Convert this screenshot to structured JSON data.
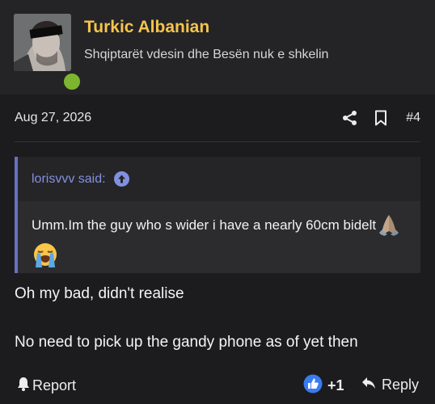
{
  "user": {
    "name": "Turkic Albanian",
    "title": "Shqiptarët vdesin dhe Besën nuk e shkelin",
    "online": true
  },
  "post": {
    "date": "Aug 27, 2026",
    "number": "#4",
    "share_icon": "share-icon",
    "bookmark_icon": "bookmark-icon"
  },
  "quote": {
    "author": "lorisvvv said:",
    "arrow_icon": "arrow-up-circle-icon",
    "text": "Umm.Im the guy who s wider i have a nearly 60cm bidelt",
    "emojis": [
      "folded-hands-emoji",
      "loudly-crying-face-emoji"
    ]
  },
  "message": {
    "lines": [
      "Oh my bad, didn't realise",
      "No need to pick up the gandy phone as of yet then"
    ]
  },
  "footer": {
    "report_label": "Report",
    "report_icon": "bell-icon",
    "reaction_icon": "thumbs-up-icon",
    "reaction_count": "+1",
    "reply_label": "Reply",
    "reply_icon": "reply-arrow-icon"
  },
  "colors": {
    "username": "#f5c44d",
    "quote_accent": "#6771c4",
    "quote_author": "#8190e0",
    "online": "#7db52f",
    "reaction": "#3a7bef"
  }
}
